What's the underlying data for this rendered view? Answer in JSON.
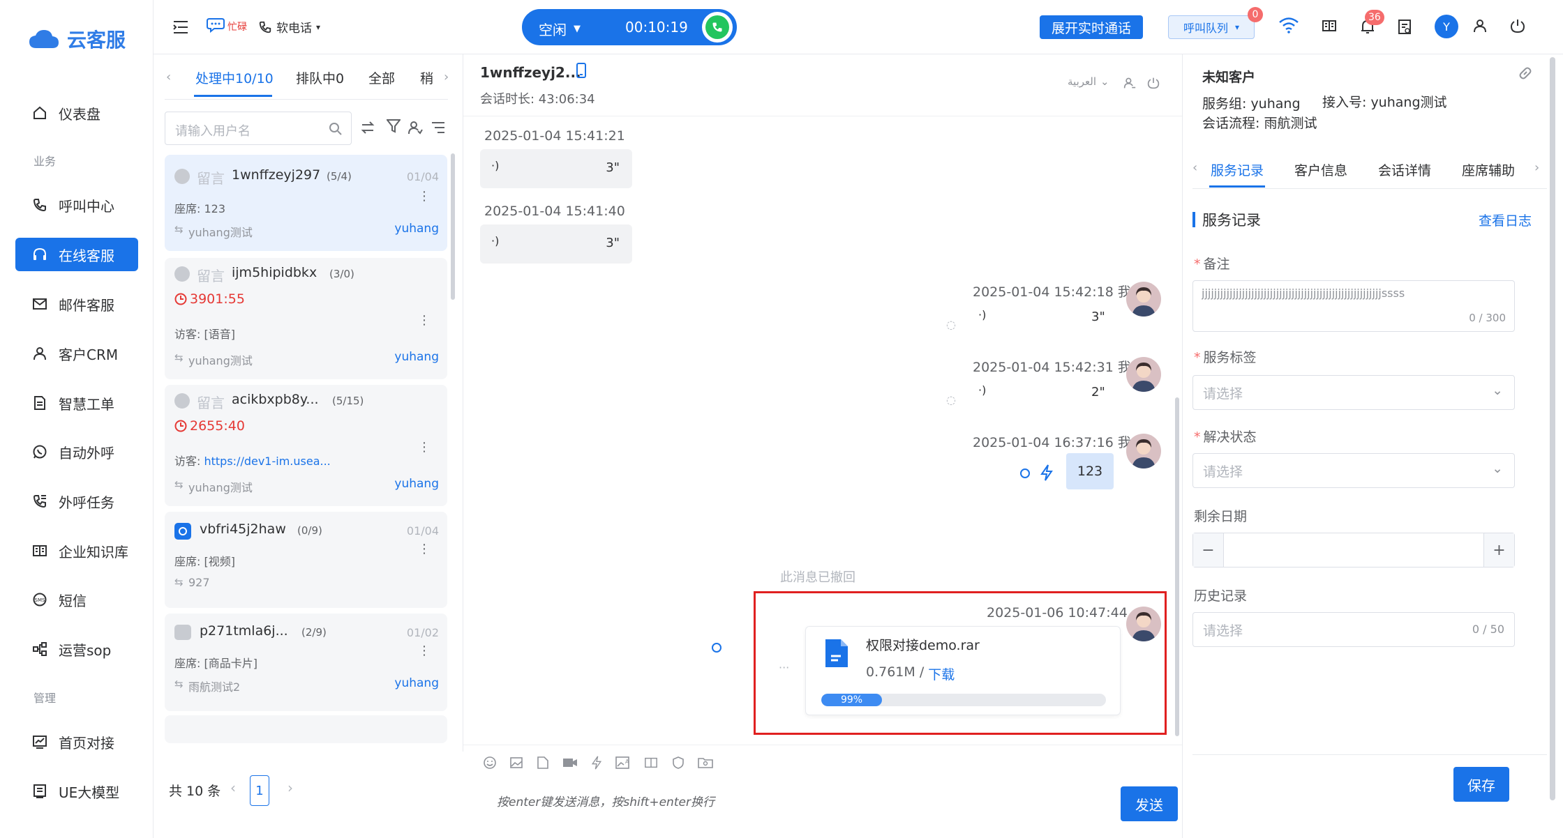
{
  "brand": {
    "name": "云客服",
    "color": "#2f7ce6"
  },
  "sidebar": {
    "items": [
      {
        "label": "仪表盘",
        "icon": "home-icon"
      },
      {
        "label": "呼叫中心",
        "icon": "phone-icon"
      },
      {
        "label": "在线客服",
        "icon": "headset-icon"
      },
      {
        "label": "邮件客服",
        "icon": "mail-icon"
      },
      {
        "label": "客户CRM",
        "icon": "user-icon"
      },
      {
        "label": "智慧工单",
        "icon": "document-icon"
      },
      {
        "label": "自动外呼",
        "icon": "whatsapp-icon"
      },
      {
        "label": "外呼任务",
        "icon": "phone-task-icon"
      },
      {
        "label": "企业知识库",
        "icon": "book-icon"
      },
      {
        "label": "短信",
        "icon": "sms-icon"
      },
      {
        "label": "运营sop",
        "icon": "flow-icon"
      },
      {
        "label": "首页对接",
        "icon": "chart-icon"
      },
      {
        "label": "UE大模型",
        "icon": "model-icon"
      }
    ],
    "groups": [
      "业务",
      "管理"
    ],
    "active_color": "#1a73e8"
  },
  "topbar": {
    "status_busy": "忙碌",
    "softphone": "软电话",
    "call_status": "空闲",
    "call_timer": "00:10:19",
    "expand_button": "展开实时通话",
    "queue_button": "呼叫队列",
    "queue_badge": "0",
    "notify_badge": "36",
    "user_initial": "Y"
  },
  "list": {
    "tabs": [
      "处理中10/10",
      "排队中0",
      "全部",
      "稍"
    ],
    "search_placeholder": "请输入用户名",
    "items": [
      {
        "tag": "留言",
        "name": "1wnffzeyj297",
        "count": "(5/4)",
        "date": "01/04",
        "line2": "座席: 123",
        "group": "yuhang测试",
        "agent": "yuhang"
      },
      {
        "tag": "留言",
        "name": "ijm5hipidbkx",
        "count": "(3/0)",
        "timer": "3901:55",
        "line2": "访客: [语音]",
        "group": "yuhang测试",
        "agent": "yuhang"
      },
      {
        "tag": "留言",
        "name": "acikbxpb8y...",
        "count": "(5/15)",
        "timer": "2655:40",
        "line2_prefix": "访客: ",
        "line2_link": "https://dev1-im.usea...",
        "group": "yuhang测试",
        "agent": "yuhang"
      },
      {
        "name": "vbfri45j2haw",
        "count": "(0/9)",
        "date": "01/04",
        "line2": "座席: [视频]",
        "group": "927"
      },
      {
        "name": "p271tmla6j...",
        "count": "(2/9)",
        "date": "01/02",
        "line2": "座席: [商品卡片]",
        "group": "雨航测试2",
        "agent": "yuhang"
      }
    ],
    "total": "共 10 条",
    "page": "1"
  },
  "chat": {
    "title": "1wnffzeyj2...",
    "duration": "会话时长: 43:06:34",
    "language": "العربية",
    "messages": [
      {
        "time": "2025-01-04 15:41:21",
        "duration": "3\""
      },
      {
        "time": "2025-01-04 15:41:40",
        "duration": "3\""
      },
      {
        "time": "2025-01-04 15:42:18 我",
        "duration": "3\""
      },
      {
        "time": "2025-01-04 15:42:31 我",
        "duration": "2\""
      },
      {
        "time": "2025-01-04 16:37:16 我",
        "text": "123"
      }
    ],
    "recalled": "此消息已撤回",
    "file": {
      "time": "2025-01-06 10:47:44",
      "name": "权限对接demo.rar",
      "size": "0.761M /",
      "download": "下载",
      "progress": 0.99,
      "progress_label": "99%"
    },
    "input_placeholder": "按enter键发送消息，按shift+enter换行",
    "send": "发送",
    "highlight_color": "#e02020"
  },
  "right": {
    "title": "未知客户",
    "service_group": "服务组: yuhang",
    "entry": "接入号: yuhang测试",
    "flow": "会话流程: 雨航测试",
    "tabs": [
      "服务记录",
      "客户信息",
      "会话详情",
      "座席辅助"
    ],
    "section": "服务记录",
    "view_log": "查看日志",
    "note_label": "备注",
    "note_value": "jjjjjjjjjjjjjjjjjjjjjjjjjjjjjjjjjjjjjjjjjjjjjjjjjjjjjjjjjjssss",
    "note_count": "0 / 300",
    "tag_label": "服务标签",
    "tag_placeholder": "请选择",
    "status_label": "解决状态",
    "status_placeholder": "请选择",
    "remain_label": "剩余日期",
    "history_label": "历史记录",
    "history_placeholder": "请选择",
    "history_count": "0 / 50",
    "save": "保存"
  }
}
